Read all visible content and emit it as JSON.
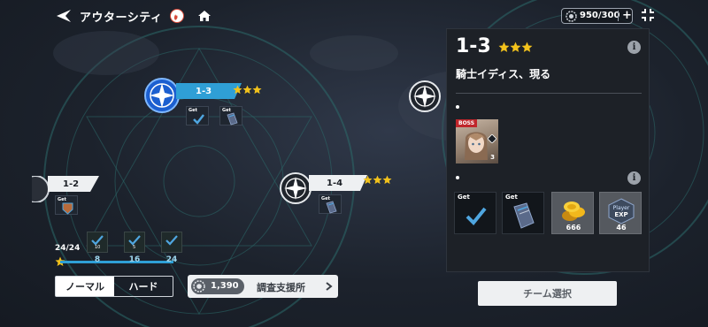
{
  "header": {
    "title": "アウターシティ",
    "stamina": "950/300",
    "stamina_plus": "+"
  },
  "stages": {
    "s13": {
      "label": "1-3",
      "stars": 3,
      "rewards": [
        {
          "get": "Get",
          "icon": "check-icon"
        },
        {
          "get": "Get",
          "icon": "book-icon"
        }
      ]
    },
    "s12": {
      "label": "1-2",
      "rewards": [
        {
          "get": "Get",
          "icon": "emblem-icon"
        }
      ]
    },
    "s14": {
      "label": "1-4",
      "stars": 3,
      "rewards": [
        {
          "get": "Get",
          "icon": "book-icon"
        }
      ]
    }
  },
  "progress": {
    "count": "24/24",
    "milestones": [
      {
        "value": "8",
        "mini": "10"
      },
      {
        "value": "16",
        "mini": "5"
      },
      {
        "value": "24",
        "mini": ""
      }
    ]
  },
  "difficulty": {
    "normal": "ノーマル",
    "hard": "ハード",
    "selected": "hard"
  },
  "research": {
    "count": "1,390",
    "label": "調査支援所"
  },
  "detail": {
    "stage": "1-3",
    "stars": 3,
    "subtitle": "騎士イディス、現る",
    "boss_tag": "BOSS",
    "boss_level": "3",
    "rewards": [
      {
        "get": "Get",
        "icon": "check-icon",
        "qty": ""
      },
      {
        "get": "Get",
        "icon": "book-icon",
        "qty": ""
      },
      {
        "get": "",
        "icon": "gold-coins-icon",
        "qty": "666"
      },
      {
        "get": "",
        "icon": "player-exp-icon",
        "qty": "46",
        "icon_text_1": "Player",
        "icon_text_2": "EXP"
      }
    ],
    "team_select": "チーム選択"
  },
  "colors": {
    "accent_blue": "#2f9fd6",
    "star_gold": "#f2c21c",
    "boss_red": "#c0262b"
  }
}
